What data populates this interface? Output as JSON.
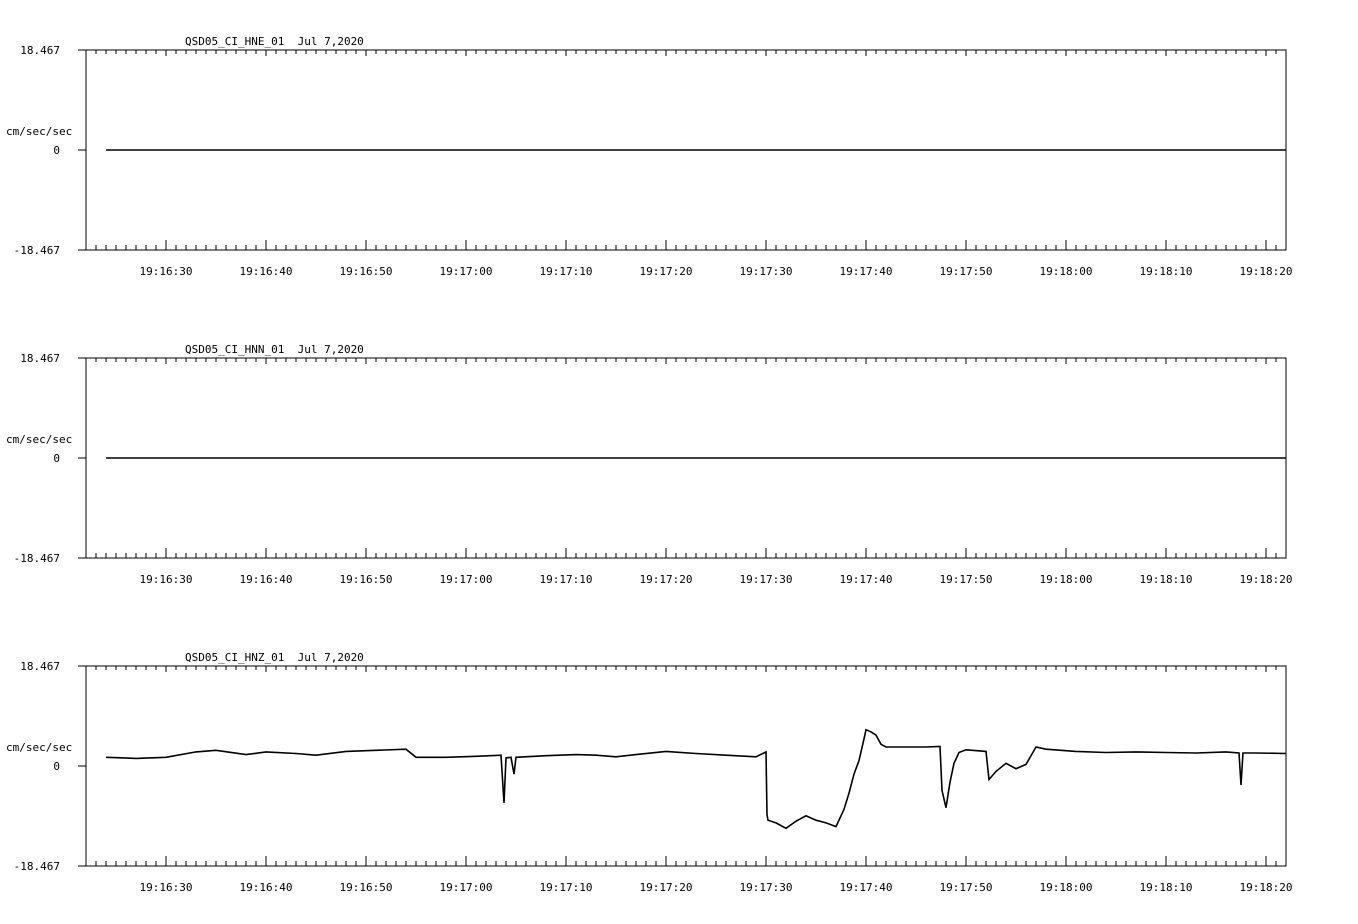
{
  "x_tick_labels": [
    "19:16:30",
    "19:16:40",
    "19:16:50",
    "19:17:00",
    "19:17:10",
    "19:17:20",
    "19:17:30",
    "19:17:40",
    "19:17:50",
    "19:18:00",
    "19:18:10",
    "19:18:20"
  ],
  "chart_data": [
    {
      "type": "line",
      "title": "QSD05_CI_HNE_01  Jul 7,2020",
      "ylabel": "cm/sec/sec",
      "y_tick_labels": [
        "18.467",
        "0",
        "-18.467"
      ],
      "ylim": [
        -18.467,
        18.467
      ],
      "xlim_seconds": [
        "19:16:22",
        "19:18:22"
      ],
      "series": [
        {
          "x": [
            "19:16:24",
            "19:18:22"
          ],
          "values": [
            0,
            0
          ]
        }
      ]
    },
    {
      "type": "line",
      "title": "QSD05_CI_HNN_01  Jul 7,2020",
      "ylabel": "cm/sec/sec",
      "y_tick_labels": [
        "18.467",
        "0",
        "-18.467"
      ],
      "ylim": [
        -18.467,
        18.467
      ],
      "xlim_seconds": [
        "19:16:22",
        "19:18:22"
      ],
      "series": [
        {
          "x": [
            "19:16:24",
            "19:18:22"
          ],
          "values": [
            0,
            0
          ]
        }
      ]
    },
    {
      "type": "line",
      "title": "QSD05_CI_HNZ_01  Jul 7,2020",
      "ylabel": "cm/sec/sec",
      "y_tick_labels": [
        "18.467",
        "0",
        "-18.467"
      ],
      "ylim": [
        -18.467,
        18.467
      ],
      "xlim_seconds": [
        "19:16:22",
        "19:18:22"
      ],
      "series": [
        {
          "x": [
            "19:16:24",
            "19:16:27",
            "19:16:30",
            "19:16:33",
            "19:16:35",
            "19:16:38",
            "19:16:40",
            "19:16:43",
            "19:16:45",
            "19:16:48",
            "19:16:51",
            "19:16:54",
            "19:16:55",
            "19:16:58",
            "19:17:01",
            "19:17:03.5",
            "19:17:03.8",
            "19:17:04",
            "19:17:04.5",
            "19:17:04.8",
            "19:17:05",
            "19:17:08",
            "19:17:11",
            "19:17:13",
            "19:17:15",
            "19:17:17",
            "19:17:20",
            "19:17:23",
            "19:17:26",
            "19:17:29",
            "19:17:30",
            "19:17:30.1",
            "19:17:30.2",
            "19:17:31",
            "19:17:32",
            "19:17:33",
            "19:17:34",
            "19:17:35",
            "19:17:36",
            "19:17:37",
            "19:17:37.8",
            "19:17:38.3",
            "19:17:38.8",
            "19:17:39.3",
            "19:17:39.8",
            "19:17:40",
            "19:17:40.5",
            "19:17:41",
            "19:17:41.5",
            "19:17:42",
            "19:17:44",
            "19:17:46",
            "19:17:47.4",
            "19:17:47.6",
            "19:17:48",
            "19:17:48.4",
            "19:17:48.8",
            "19:17:49.3",
            "19:17:50",
            "19:17:52",
            "19:17:52.3",
            "19:17:53",
            "19:17:54",
            "19:17:55",
            "19:17:56",
            "19:17:57",
            "19:17:58",
            "19:18:01",
            "19:18:04",
            "19:18:07",
            "19:18:10",
            "19:18:13",
            "19:18:16",
            "19:18:17.3",
            "19:18:17.5",
            "19:18:17.7",
            "19:18:19",
            "19:18:22"
          ],
          "values": [
            1.6,
            1.4,
            1.6,
            2.6,
            2.9,
            2.1,
            2.6,
            2.3,
            2.0,
            2.7,
            2.9,
            3.1,
            1.6,
            1.6,
            1.8,
            2.0,
            -6.8,
            1.5,
            1.6,
            -1.5,
            1.6,
            1.9,
            2.1,
            2.0,
            1.7,
            2.1,
            2.7,
            2.3,
            2.0,
            1.7,
            2.6,
            -9.0,
            -10.0,
            -10.5,
            -11.5,
            -10.2,
            -9.2,
            -10.0,
            -10.5,
            -11.2,
            -8.0,
            -5.0,
            -1.5,
            1.0,
            5.0,
            6.7,
            6.3,
            5.7,
            4.0,
            3.5,
            3.5,
            3.5,
            3.6,
            -4.5,
            -7.7,
            -3.0,
            0.5,
            2.5,
            3.0,
            2.7,
            -2.5,
            -1.0,
            0.5,
            -0.5,
            0.3,
            3.5,
            3.1,
            2.7,
            2.5,
            2.6,
            2.5,
            2.4,
            2.6,
            2.4,
            -3.5,
            2.4,
            2.4,
            2.3
          ]
        }
      ]
    }
  ]
}
